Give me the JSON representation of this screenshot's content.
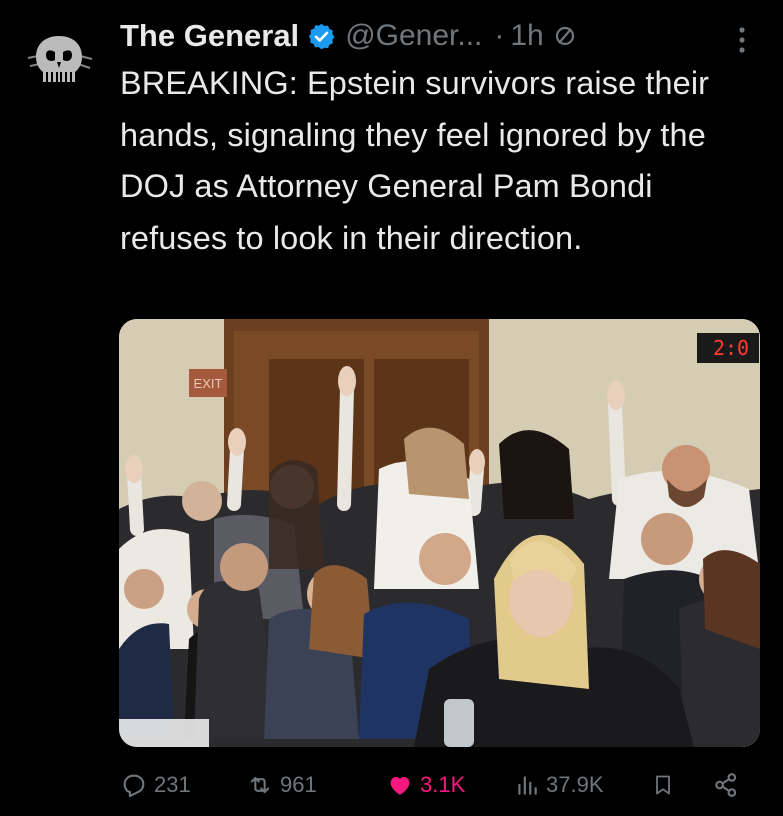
{
  "tweet": {
    "author": {
      "display_name": "The General",
      "handle": "@Gener...",
      "verified": true,
      "avatar_icon": "punisher-skull-icon"
    },
    "separator": "·",
    "timestamp": "1h",
    "text": "BREAKING: Epstein survivors raise their hands, signaling they feel ignored by the DOJ as Attorney General Pam Bondi refuses to look in their direction.",
    "media": {
      "exit_sign": "EXIT",
      "clock_display": "2:0"
    },
    "actions": {
      "replies": "231",
      "reposts": "961",
      "likes": "3.1K",
      "views": "37.9K"
    },
    "colors": {
      "background": "#000000",
      "text": "#e7e9ea",
      "muted": "#71767b",
      "like": "#f91880",
      "verified": "#1d9bf0"
    }
  }
}
